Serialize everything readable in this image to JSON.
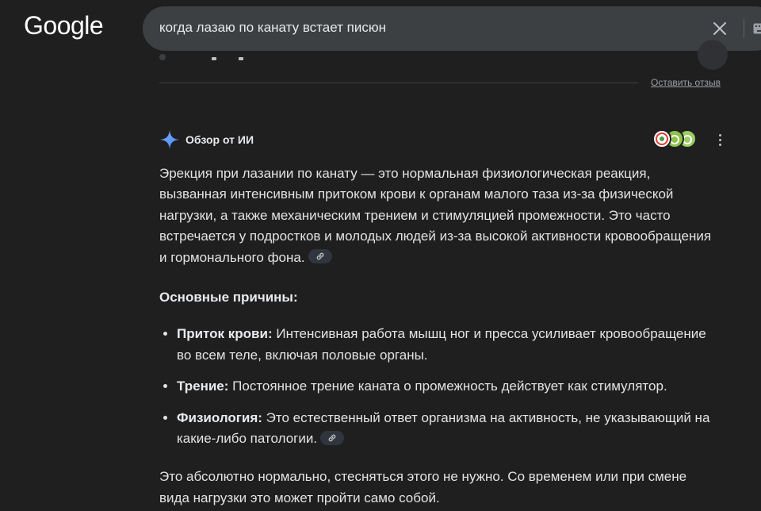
{
  "header": {
    "logo": "Google",
    "search_query": "когда лазаю по канату встает писюн"
  },
  "feedback": {
    "label": "Оставить отзыв"
  },
  "ai_overview": {
    "title": "Обзор от ИИ",
    "intro": "Эрекция при лазании по канату — это нормальная физиологическая реакция, вызванная интенсивным притоком крови к органам малого таза из-за физической нагрузки, а также механическим трением и стимуляцией промежности. Это часто встречается у подростков и молодых людей из-за высокой активности кровообращения и гормонального фона.",
    "section_title": "Основные причины:",
    "reasons": [
      {
        "term": "Приток крови:",
        "text": " Интенсивная работа мышц ног и пресса усиливает кровообращение во всем теле, включая половые органы."
      },
      {
        "term": "Трение:",
        "text": " Постоянное трение каната о промежность действует как стимулятор."
      },
      {
        "term": "Физиология:",
        "text": " Это естественный ответ организма на активность, не указывающий на какие-либо патологии."
      }
    ],
    "closing": "Это абсолютно нормально, стесняться этого не нужно. Со временем или при смене вида нагрузки это может пройти само собой."
  },
  "colors": {
    "background": "#1f1f1f",
    "searchbar": "#3c4043",
    "text": "#e3e3e3",
    "star_blue": "#4285f4",
    "avatar_green": "#8bc34a"
  },
  "icons": [
    "close-icon",
    "keyboard-icon",
    "ai-sparkle-icon",
    "more-vert-icon",
    "link-icon"
  ]
}
